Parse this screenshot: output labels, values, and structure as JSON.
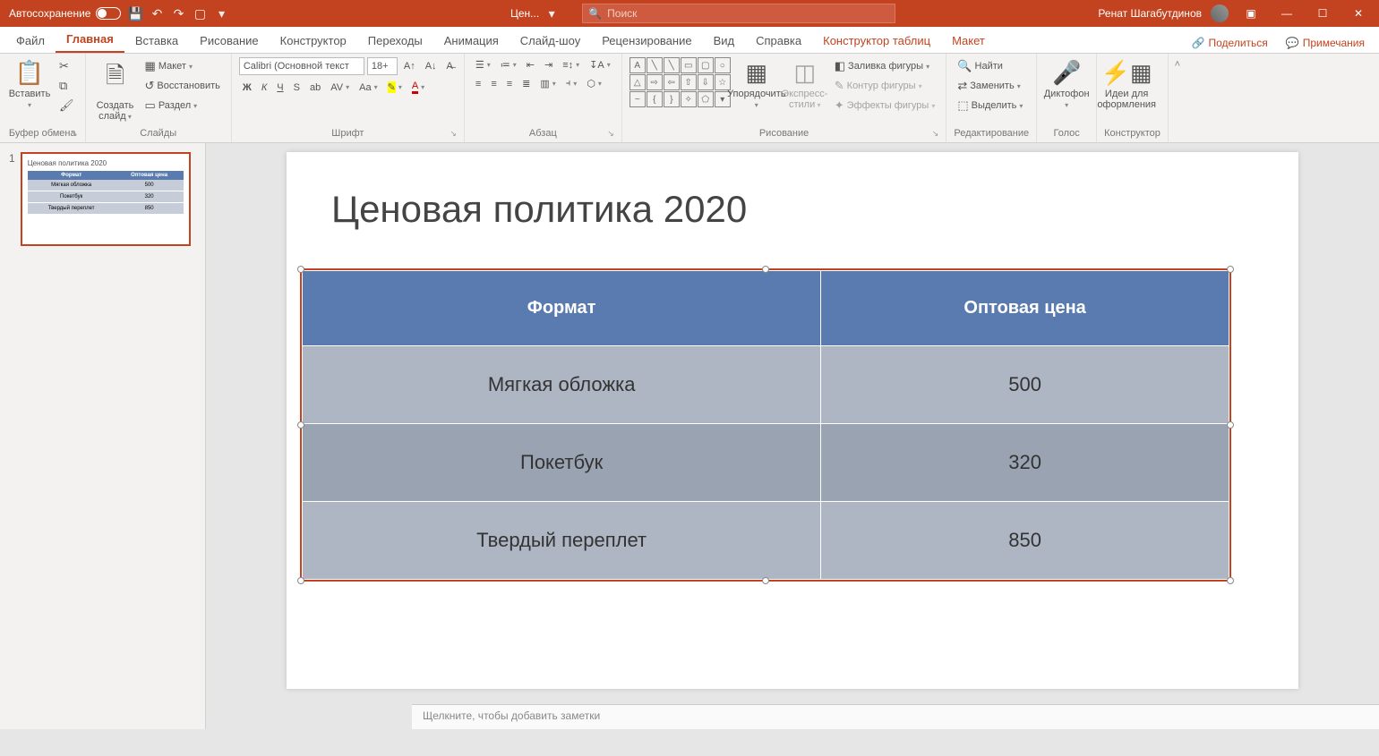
{
  "titlebar": {
    "autosave": "Автосохранение",
    "doc": "Цен...",
    "search_placeholder": "Поиск",
    "user": "Ренат Шагабутдинов"
  },
  "tabs": {
    "file": "Файл",
    "home": "Главная",
    "insert": "Вставка",
    "draw": "Рисование",
    "design": "Конструктор",
    "transitions": "Переходы",
    "animations": "Анимация",
    "slideshow": "Слайд-шоу",
    "review": "Рецензирование",
    "view": "Вид",
    "help": "Справка",
    "tabledesign": "Конструктор таблиц",
    "layout": "Макет",
    "share": "Поделиться",
    "comments": "Примечания"
  },
  "ribbon": {
    "clipboard": {
      "paste": "Вставить",
      "label": "Буфер обмена"
    },
    "slides": {
      "new": "Создать слайд",
      "layout": "Макет",
      "reset": "Восстановить",
      "section": "Раздел",
      "label": "Слайды"
    },
    "font": {
      "name": "Calibri (Основной текст",
      "size": "18+",
      "label": "Шрифт"
    },
    "para": {
      "label": "Абзац"
    },
    "drawing": {
      "arrange": "Упорядочить",
      "styles": "Экспресс-стили",
      "fill": "Заливка фигуры",
      "outline": "Контур фигуры",
      "effects": "Эффекты фигуры",
      "label": "Рисование"
    },
    "editing": {
      "find": "Найти",
      "replace": "Заменить",
      "select": "Выделить",
      "label": "Редактирование"
    },
    "voice": {
      "dictate": "Диктофон",
      "label": "Голос"
    },
    "designer": {
      "ideas": "Идеи для оформления",
      "label": "Конструктор"
    }
  },
  "slide": {
    "number": "1",
    "title": "Ценовая политика 2020",
    "table": {
      "headers": [
        "Формат",
        "Оптовая цена"
      ],
      "rows": [
        [
          "Мягкая обложка",
          "500"
        ],
        [
          "Покетбук",
          "320"
        ],
        [
          "Твердый переплет",
          "850"
        ]
      ]
    }
  },
  "notes_placeholder": "Щелкните, чтобы добавить заметки"
}
